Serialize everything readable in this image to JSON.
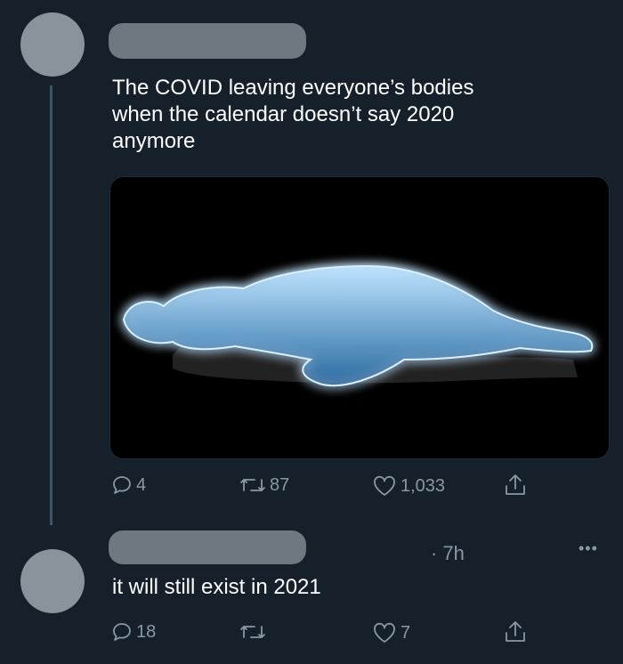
{
  "tweet": {
    "text_lines": [
      "The COVID leaving everyone’s bodies",
      "when the calendar doesn’t say 2020",
      "anymore"
    ],
    "media": {
      "description_icon": "glowing-spirit-body-image"
    },
    "actions": {
      "reply_count": "4",
      "retweet_count": "87",
      "like_count": "1,033"
    }
  },
  "reply": {
    "timestamp": "· 7h",
    "more_label": "•••",
    "text": "it will still exist in 2021",
    "actions": {
      "reply_count": "18",
      "retweet_count": "",
      "like_count": "7"
    }
  },
  "colors": {
    "background": "#15202b",
    "secondary_text": "#8899a6",
    "thread_line": "#3d5466",
    "glow": "#7fc6ff"
  }
}
